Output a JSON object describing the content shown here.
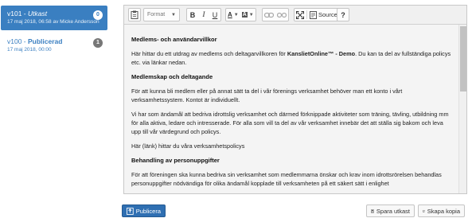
{
  "versions": [
    {
      "label": "v101",
      "separator": " - ",
      "status": "Utkast",
      "meta": "17 maj 2018, 06:58 av Micke Andersson",
      "badge": "0",
      "active": true
    },
    {
      "label": "v100",
      "separator": " - ",
      "status": "Publicerad",
      "meta": "17 maj 2018, 00:00",
      "badge": "1",
      "active": false
    }
  ],
  "toolbar": {
    "format_placeholder": "Format",
    "bold": "B",
    "italic": "I",
    "underline": "U",
    "text_color": "A",
    "bg_color": "A",
    "source_label": "Source",
    "help": "?"
  },
  "document": {
    "heading1": "Medlems- och användarvillkor",
    "p1_start": "Här hittar du ett utdrag av medlems och deltagarvillkoren för ",
    "p1_bold": "KanslietOnline™ - Demo",
    "p1_end": ". Du kan ta del av fullständiga policys etc. via länkar nedan.",
    "heading2": "Medlemskap och deltagande",
    "p2": "För att kunna bli medlem eller på annat sätt ta del i vår förenings verksamhet behöver man ett konto i vårt verksamhetssystem. Kontot är individuellt.",
    "p3": "Vi har som ändamål att bedriva idrottslig verksamhet och därmed förknippade aktiviteter som träning, tävling, utbildning mm för alla aktiva, ledare och intresserade. För alla som vill ta del av vår verksamhet innebär det att ställa sig bakom och leva upp till vår värdegrund och policys.",
    "p4": "Här (länk) hittar du våra verksamhetspolicys",
    "heading3": "Behandling av personuppgifter",
    "p5": "För att föreningen ska kunna bedriva sin verksamhet som medlemmarna önskar och krav inom idrottsrörelsen behandlas personuppgifter nödvändiga för olika ändamål kopplade till verksamheten på ett säkert sätt i enlighet"
  },
  "actions": {
    "publish": "Publicera",
    "save_draft": "Spara utkast",
    "create_copy": "Skapa kopia"
  },
  "colors": {
    "accent": "#3a7fc1",
    "primary_button": "#2f6fb2",
    "badge_inactive": "#777777"
  },
  "icons": {
    "paste": "paste-icon",
    "link": "link-icon",
    "unlink": "unlink-icon",
    "maximize": "maximize-icon",
    "source": "source-icon",
    "publish": "upload-icon",
    "save": "floppy-disk-icon",
    "copy": "copy-icon"
  }
}
